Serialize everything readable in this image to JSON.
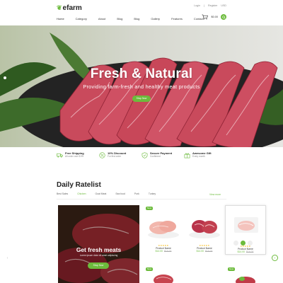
{
  "brand": {
    "logo": "efarm",
    "accent": "#6cbb3c"
  },
  "top_links": [
    "Login",
    "Register",
    "USD"
  ],
  "nav": [
    "Home",
    "Category",
    "About",
    "Blog",
    "Blog",
    "Gallery",
    "Features",
    "Contact"
  ],
  "header": {
    "cart_price": "$0.00"
  },
  "hero": {
    "title": "Fresh & Natural",
    "subtitle": "Providing farm-fresh and healthy meat products",
    "button": "Shop Now"
  },
  "features": [
    {
      "title": "Free Shipping",
      "desc": "All order over $ 99",
      "icon": "truck-icon"
    },
    {
      "title": "10% Discount",
      "desc": "For first order",
      "icon": "percent-icon"
    },
    {
      "title": "Secure Payment",
      "desc": "Confirmed",
      "icon": "shield-icon"
    },
    {
      "title": "Awesome Gift",
      "desc": "Every month",
      "icon": "gift-icon"
    }
  ],
  "ratelist": {
    "title": "Daily Ratelist",
    "tabs": [
      "Best Sales",
      "Chicken",
      "Goat Meat",
      "Sea food",
      "Pork",
      "Turkey"
    ],
    "active_tab": "Chicken",
    "view_more": "View more"
  },
  "promo": {
    "title": "Get fresh meats",
    "subtitle": "Lorem ipsum dolor sit amet adipiscing",
    "button": "Shop Now"
  },
  "products": [
    {
      "name": "Product Name",
      "price": "$14.00",
      "old_price": "$16.00",
      "badge": "New",
      "rating": "★★★★★"
    },
    {
      "name": "Product Name",
      "price": "$14.00",
      "old_price": "$16.00",
      "badge": "",
      "rating": "★★★★★"
    },
    {
      "name": "Product Name",
      "price": "$14.00",
      "old_price": "$16.00",
      "badge": "",
      "rating": "★★★★★"
    }
  ],
  "bottom_badges": [
    "New",
    "New"
  ]
}
